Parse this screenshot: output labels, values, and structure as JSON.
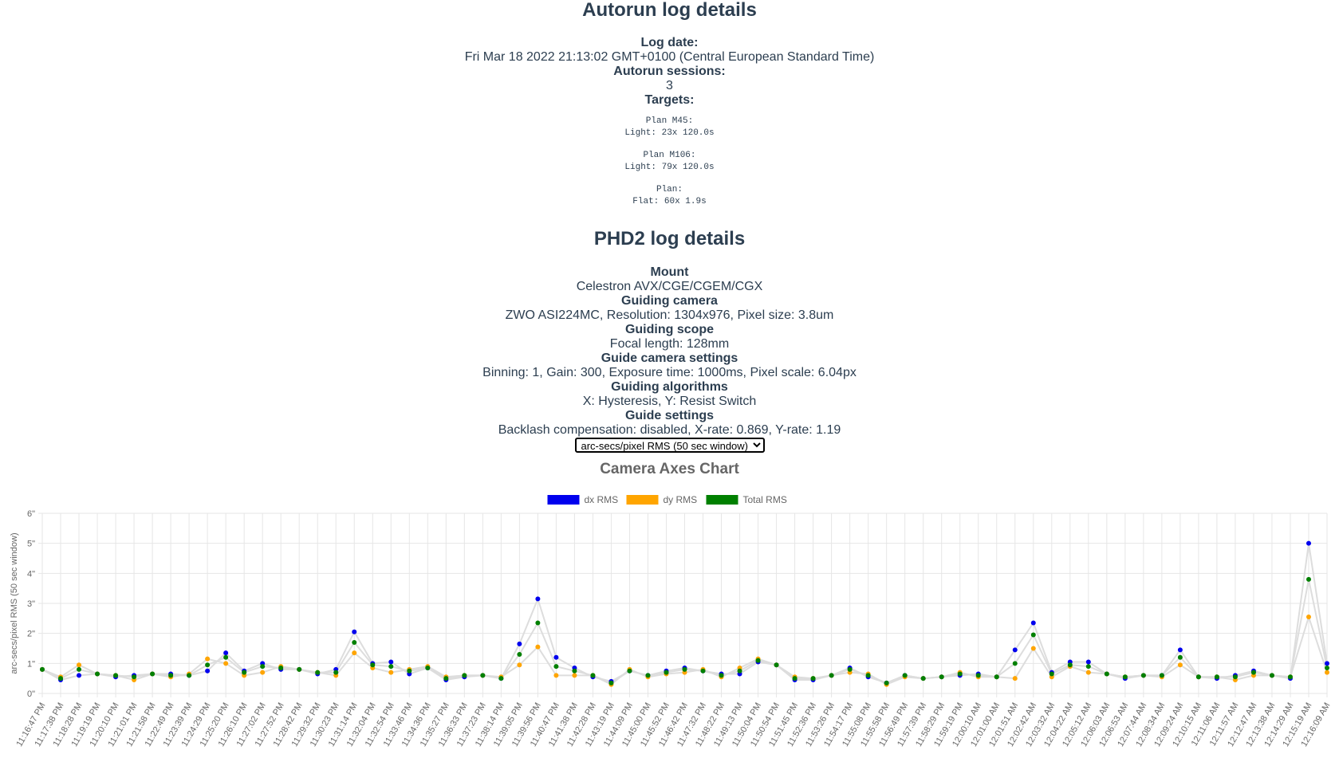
{
  "autorun": {
    "title": "Autorun log details",
    "log_date_label": "Log date:",
    "log_date": "Fri Mar 18 2022 21:13:02 GMT+0100 (Central European Standard Time)",
    "sessions_label": "Autorun sessions:",
    "sessions": "3",
    "targets_label": "Targets:",
    "targets": [
      {
        "plan": "Plan M45:",
        "detail": "Light: 23x 120.0s"
      },
      {
        "plan": "Plan M106:",
        "detail": "Light: 79x 120.0s"
      },
      {
        "plan": "Plan:",
        "detail": "Flat: 60x 1.9s"
      }
    ]
  },
  "phd2": {
    "title": "PHD2 log details",
    "mount_label": "Mount",
    "mount": "Celestron AVX/CGE/CGEM/CGX",
    "camera_label": "Guiding camera",
    "camera": "ZWO ASI224MC, Resolution: 1304x976, Pixel size: 3.8um",
    "scope_label": "Guiding scope",
    "scope": "Focal length: 128mm",
    "cam_settings_label": "Guide camera settings",
    "cam_settings": "Binning: 1, Gain: 300, Exposure time: 1000ms, Pixel scale: 6.04px",
    "algorithms_label": "Guiding algorithms",
    "algorithms": "X: Hysteresis, Y: Resist Switch",
    "guide_settings_label": "Guide settings",
    "guide_settings": "Backlash compensation: disabled, X-rate: 0.869, Y-rate: 1.19",
    "select_value": "arc-secs/pixel RMS (50 sec window)"
  },
  "colors": {
    "dx": "#0000ee",
    "dy": "#ffa500",
    "total": "#008000",
    "line": "#dddddd",
    "grid": "#e6e6e6"
  },
  "chart_data": {
    "type": "line",
    "title": "Camera Axes Chart",
    "ylabel": "arc-secs/pixel  RMS (50 sec window)",
    "ylim": [
      0,
      6
    ],
    "yticks": [
      "0\"",
      "1\"",
      "2\"",
      "3\"",
      "4\"",
      "5\"",
      "6\""
    ],
    "legend_position": "top-center",
    "grid": true,
    "x": [
      "11:16:47 PM",
      "11:17:38 PM",
      "11:18:28 PM",
      "11:19:19 PM",
      "11:20:10 PM",
      "11:21:01 PM",
      "11:21:58 PM",
      "11:22:49 PM",
      "11:23:39 PM",
      "11:24:29 PM",
      "11:25:20 PM",
      "11:26:10 PM",
      "11:27:02 PM",
      "11:27:52 PM",
      "11:28:42 PM",
      "11:29:32 PM",
      "11:30:23 PM",
      "11:31:14 PM",
      "11:32:04 PM",
      "11:32:54 PM",
      "11:33:46 PM",
      "11:34:36 PM",
      "11:35:27 PM",
      "11:36:33 PM",
      "11:37:23 PM",
      "11:38:14 PM",
      "11:39:05 PM",
      "11:39:56 PM",
      "11:40:47 PM",
      "11:41:38 PM",
      "11:42:28 PM",
      "11:43:19 PM",
      "11:44:09 PM",
      "11:45:00 PM",
      "11:45:52 PM",
      "11:46:42 PM",
      "11:47:32 PM",
      "11:48:22 PM",
      "11:49:13 PM",
      "11:50:04 PM",
      "11:50:54 PM",
      "11:51:45 PM",
      "11:52:36 PM",
      "11:53:26 PM",
      "11:54:17 PM",
      "11:55:08 PM",
      "11:55:58 PM",
      "11:56:49 PM",
      "11:57:39 PM",
      "11:58:29 PM",
      "11:59:19 PM",
      "12:00:10 AM",
      "12:01:00 AM",
      "12:01:51 AM",
      "12:02:42 AM",
      "12:03:32 AM",
      "12:04:22 AM",
      "12:05:12 AM",
      "12:06:03 AM",
      "12:06:53 AM",
      "12:07:44 AM",
      "12:08:34 AM",
      "12:09:24 AM",
      "12:10:15 AM",
      "12:11:06 AM",
      "12:11:57 AM",
      "12:12:47 AM",
      "12:13:38 AM",
      "12:14:29 AM",
      "12:15:19 AM",
      "12:16:09 AM"
    ],
    "series": [
      {
        "name": "dx RMS",
        "values": [
          0.8,
          0.45,
          0.6,
          0.65,
          0.55,
          0.6,
          0.65,
          0.65,
          0.6,
          0.75,
          1.35,
          0.75,
          1.0,
          0.8,
          0.8,
          0.65,
          0.8,
          2.05,
          1.0,
          1.05,
          0.65,
          0.85,
          0.45,
          0.55,
          0.6,
          0.5,
          1.65,
          3.15,
          1.2,
          0.85,
          0.55,
          0.4,
          0.75,
          0.6,
          0.75,
          0.85,
          0.75,
          0.65,
          0.65,
          1.05,
          0.95,
          0.45,
          0.45,
          0.6,
          0.85,
          0.55,
          0.35,
          0.6,
          0.5,
          0.55,
          0.6,
          0.65,
          0.55,
          1.45,
          2.35,
          0.7,
          1.05,
          1.05,
          0.65,
          0.5,
          0.6,
          0.6,
          1.45,
          0.55,
          0.5,
          0.6,
          0.75,
          0.6,
          0.5,
          5.0,
          1.0
        ]
      },
      {
        "name": "dy RMS",
        "values": [
          0.8,
          0.55,
          0.95,
          0.65,
          0.6,
          0.45,
          0.65,
          0.55,
          0.65,
          1.15,
          1.0,
          0.6,
          0.7,
          0.9,
          0.8,
          0.7,
          0.6,
          1.35,
          0.85,
          0.7,
          0.8,
          0.9,
          0.55,
          0.6,
          0.6,
          0.55,
          0.95,
          1.55,
          0.6,
          0.6,
          0.6,
          0.3,
          0.8,
          0.55,
          0.65,
          0.7,
          0.8,
          0.55,
          0.85,
          1.15,
          0.95,
          0.55,
          0.5,
          0.6,
          0.7,
          0.65,
          0.3,
          0.55,
          0.5,
          0.55,
          0.7,
          0.55,
          0.55,
          0.5,
          1.5,
          0.55,
          0.9,
          0.7,
          0.65,
          0.55,
          0.6,
          0.55,
          0.95,
          0.55,
          0.55,
          0.45,
          0.6,
          0.6,
          0.55,
          2.55,
          0.7
        ]
      },
      {
        "name": "Total RMS",
        "values": [
          0.8,
          0.5,
          0.8,
          0.65,
          0.6,
          0.55,
          0.65,
          0.6,
          0.6,
          0.95,
          1.2,
          0.7,
          0.9,
          0.85,
          0.8,
          0.7,
          0.7,
          1.7,
          0.95,
          0.9,
          0.75,
          0.85,
          0.5,
          0.6,
          0.6,
          0.5,
          1.3,
          2.35,
          0.9,
          0.75,
          0.6,
          0.35,
          0.75,
          0.6,
          0.7,
          0.8,
          0.75,
          0.6,
          0.75,
          1.1,
          0.95,
          0.5,
          0.5,
          0.6,
          0.8,
          0.6,
          0.35,
          0.6,
          0.5,
          0.55,
          0.65,
          0.6,
          0.55,
          1.0,
          1.95,
          0.65,
          0.95,
          0.9,
          0.65,
          0.55,
          0.6,
          0.6,
          1.2,
          0.55,
          0.55,
          0.55,
          0.7,
          0.6,
          0.55,
          3.8,
          0.85
        ]
      }
    ]
  }
}
